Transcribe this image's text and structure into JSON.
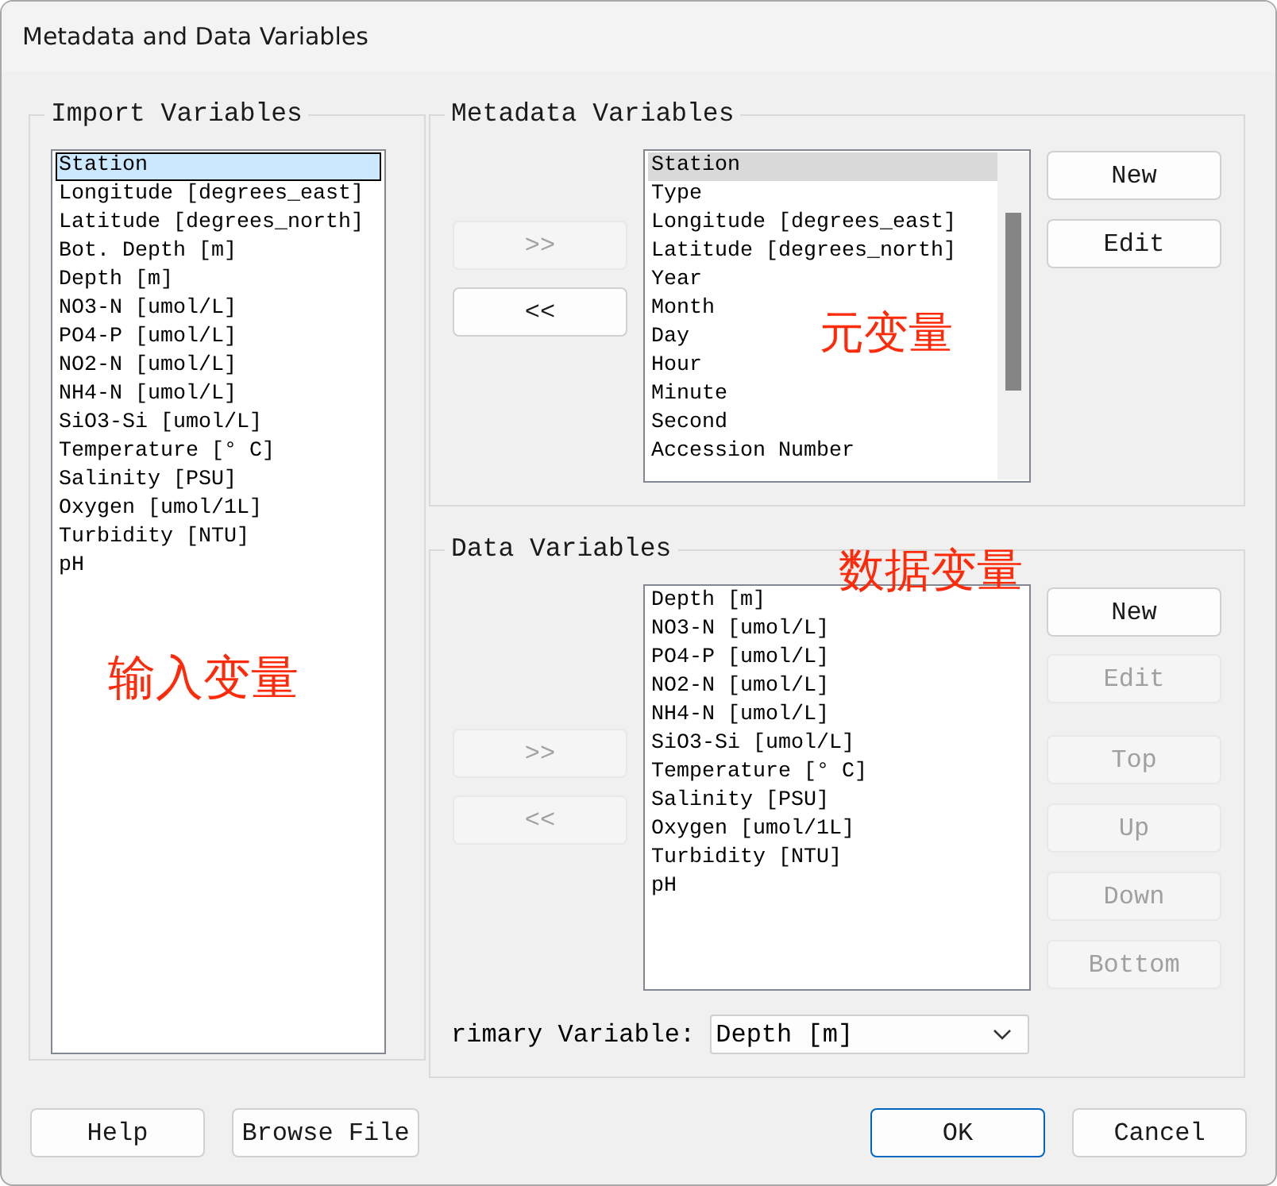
{
  "window": {
    "title": "Metadata and Data Variables"
  },
  "import_variables": {
    "title": "Import Variables",
    "items": [
      {
        "label": "Station",
        "selected": true
      },
      {
        "label": "Longitude [degrees_east]",
        "selected": false
      },
      {
        "label": "Latitude [degrees_north]",
        "selected": false
      },
      {
        "label": "Bot. Depth [m]",
        "selected": false
      },
      {
        "label": "Depth [m]",
        "selected": false
      },
      {
        "label": "NO3-N [umol/L]",
        "selected": false
      },
      {
        "label": "PO4-P [umol/L]",
        "selected": false
      },
      {
        "label": "NO2-N [umol/L]",
        "selected": false
      },
      {
        "label": "NH4-N [umol/L]",
        "selected": false
      },
      {
        "label": "SiO3-Si [umol/L]",
        "selected": false
      },
      {
        "label": "Temperature [° C]",
        "selected": false
      },
      {
        "label": "Salinity [PSU]",
        "selected": false
      },
      {
        "label": "Oxygen [umol/1L]",
        "selected": false
      },
      {
        "label": "Turbidity [NTU]",
        "selected": false
      },
      {
        "label": "pH",
        "selected": false
      }
    ]
  },
  "metadata_variables": {
    "title": "Metadata Variables",
    "move_buttons": [
      {
        "label": ">>",
        "disabled": true
      },
      {
        "label": "<<",
        "disabled": false
      }
    ],
    "items": [
      {
        "label": "Station",
        "selected": true
      },
      {
        "label": "Type",
        "selected": false
      },
      {
        "label": "Longitude [degrees_east]",
        "selected": false
      },
      {
        "label": "Latitude [degrees_north]",
        "selected": false
      },
      {
        "label": "Year",
        "selected": false
      },
      {
        "label": "Month",
        "selected": false
      },
      {
        "label": "Day",
        "selected": false
      },
      {
        "label": "Hour",
        "selected": false
      },
      {
        "label": "Minute",
        "selected": false
      },
      {
        "label": "Second",
        "selected": false
      },
      {
        "label": "Accession Number",
        "selected": false
      }
    ],
    "buttons": [
      {
        "label": "New",
        "disabled": false
      },
      {
        "label": "Edit",
        "disabled": false
      }
    ]
  },
  "data_variables": {
    "title": "Data Variables",
    "move_buttons": [
      {
        "label": ">>",
        "disabled": true
      },
      {
        "label": "<<",
        "disabled": true
      }
    ],
    "items": [
      {
        "label": "Depth [m]",
        "selected": false
      },
      {
        "label": "NO3-N [umol/L]",
        "selected": false
      },
      {
        "label": "PO4-P [umol/L]",
        "selected": false
      },
      {
        "label": "NO2-N [umol/L]",
        "selected": false
      },
      {
        "label": "NH4-N [umol/L]",
        "selected": false
      },
      {
        "label": "SiO3-Si [umol/L]",
        "selected": false
      },
      {
        "label": "Temperature [° C]",
        "selected": false
      },
      {
        "label": "Salinity [PSU]",
        "selected": false
      },
      {
        "label": "Oxygen [umol/1L]",
        "selected": false
      },
      {
        "label": "Turbidity [NTU]",
        "selected": false
      },
      {
        "label": "pH",
        "selected": false
      }
    ],
    "buttons": [
      {
        "label": "New",
        "disabled": false
      },
      {
        "label": "Edit",
        "disabled": true
      },
      {
        "label": "Top",
        "disabled": true
      },
      {
        "label": "Up",
        "disabled": true
      },
      {
        "label": "Down",
        "disabled": true
      },
      {
        "label": "Bottom",
        "disabled": true
      }
    ],
    "primary_variable": {
      "label": "rimary Variable:",
      "value": "Depth [m]"
    }
  },
  "footer_buttons": [
    {
      "label": "Help",
      "disabled": false,
      "default": false
    },
    {
      "label": "Browse File",
      "disabled": false,
      "default": false
    },
    {
      "label": "OK",
      "disabled": false,
      "default": true
    },
    {
      "label": "Cancel",
      "disabled": false,
      "default": false
    }
  ],
  "annotations": [
    {
      "text": "输入变量"
    },
    {
      "text": "元变量"
    },
    {
      "text": "数据变量"
    }
  ]
}
